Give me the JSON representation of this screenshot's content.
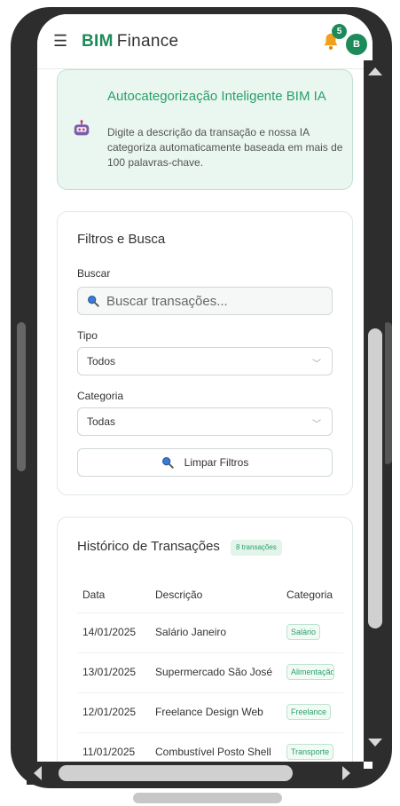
{
  "header": {
    "brand_bold": "BIM",
    "brand_rest": "Finance",
    "notification_count": "5",
    "avatar_initial": "B"
  },
  "ai_card": {
    "title": "Autocategorização Inteligente BIM IA",
    "description": "Digite a descrição da transação e nossa IA categoriza automaticamente baseada em mais de 100 palavras-chave."
  },
  "filters": {
    "title": "Filtros e Busca",
    "search_label": "Buscar",
    "search_placeholder": "Buscar transações...",
    "type_label": "Tipo",
    "type_value": "Todos",
    "category_label": "Categoria",
    "category_value": "Todas",
    "clear_label": "Limpar Filtros"
  },
  "history": {
    "title": "Histórico de Transações",
    "count_badge": "8 transações",
    "columns": [
      "Data",
      "Descrição",
      "Categoria"
    ],
    "rows": [
      {
        "date": "14/01/2025",
        "description": "Salário Janeiro",
        "category": "Salário"
      },
      {
        "date": "13/01/2025",
        "description": "Supermercado São José",
        "category": "Alimentação"
      },
      {
        "date": "12/01/2025",
        "description": "Freelance Design Web",
        "category": "Freelance"
      },
      {
        "date": "11/01/2025",
        "description": "Combustível Posto Shell",
        "category": "Transporte"
      }
    ]
  },
  "icons": {
    "menu": "menu-icon",
    "bell": "bell-icon",
    "robot": "robot-icon",
    "search": "search-icon",
    "chevron": "chevron-down-icon"
  },
  "colors": {
    "brand": "#1e8a5a",
    "accent": "#2aa06a",
    "ai_bg": "#eaf6f0",
    "bell": "#f2a01c"
  }
}
